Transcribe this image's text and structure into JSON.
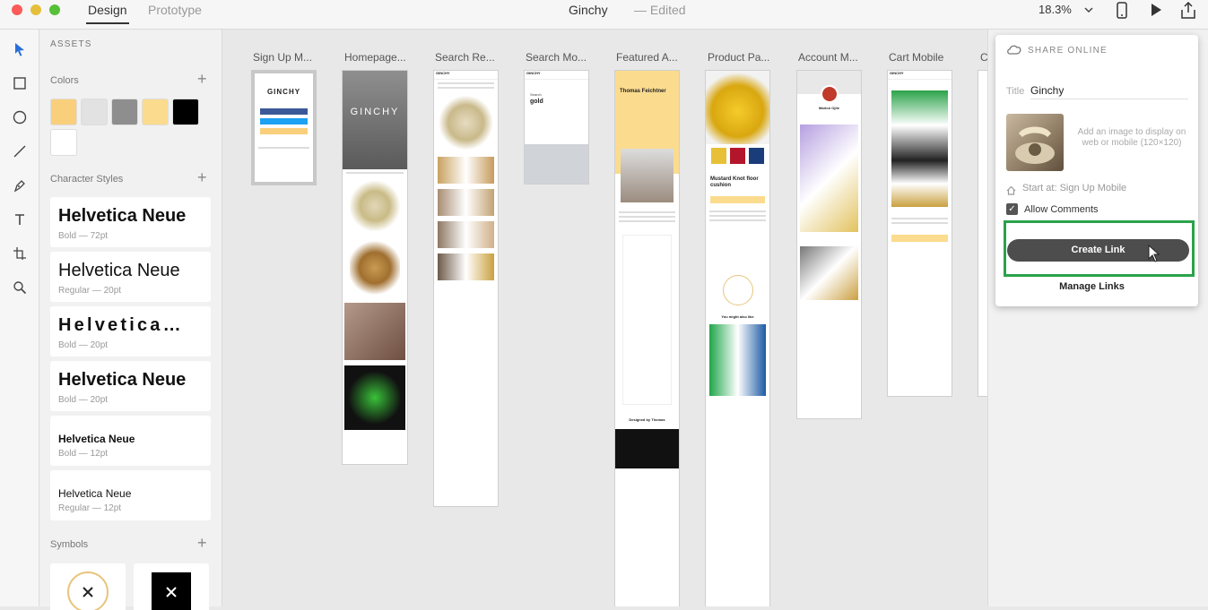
{
  "titlebar": {
    "tabs": [
      {
        "label": "Design"
      },
      {
        "label": "Prototype"
      }
    ],
    "doc_title": "Ginchy",
    "doc_status": "— Edited",
    "zoom": "18.3%"
  },
  "toolbar": {
    "tools": [
      "select-tool",
      "rectangle-tool",
      "ellipse-tool",
      "line-tool",
      "pen-tool",
      "text-tool",
      "artboard-tool",
      "zoom-tool"
    ]
  },
  "assets": {
    "heading": "ASSETS",
    "colors_title": "Colors",
    "colors": [
      "#f9cf7c",
      "#e2e2e2",
      "#8e8e8e",
      "#fbdb8e",
      "#000000",
      "#ffffff"
    ],
    "char_styles_title": "Character Styles",
    "char_styles": [
      {
        "name": "Helvetica Neue",
        "meta": "Bold — 72pt"
      },
      {
        "name": "Helvetica Neue",
        "meta": "Regular — 20pt"
      },
      {
        "name": "Helvetica…",
        "meta": "Bold — 20pt"
      },
      {
        "name": "Helvetica Neue",
        "meta": "Bold — 20pt"
      },
      {
        "name": "Helvetica Neue",
        "meta": "Bold — 12pt"
      },
      {
        "name": "Helvetica Neue",
        "meta": "Regular — 12pt"
      }
    ],
    "symbols_title": "Symbols"
  },
  "artboards": [
    {
      "label": "Sign Up M..."
    },
    {
      "label": "Homepage..."
    },
    {
      "label": "Search Re..."
    },
    {
      "label": "Search Mo..."
    },
    {
      "label": "Featured A..."
    },
    {
      "label": "Product Pa..."
    },
    {
      "label": "Account M..."
    },
    {
      "label": "Cart Mobile"
    },
    {
      "label": "C"
    }
  ],
  "artboard_text": {
    "logo": "GINCHY",
    "search_label": "Search",
    "search_term": "gold",
    "featured_name": "Thomas Feichtner",
    "product_title": "Mustard Knot floor cushion",
    "account_name": "Marlon Ojile",
    "also_like": "You might also like",
    "designed_by": "Designed by Thomas"
  },
  "share": {
    "title": "SHARE ONLINE",
    "title_label": "Title",
    "title_value": "Ginchy",
    "image_hint": "Add an image to display on web or mobile (120×120)",
    "start_at": "Start at: Sign Up Mobile",
    "allow_comments": "Allow Comments",
    "allow_comments_checked": true,
    "create_link": "Create Link",
    "manage_links": "Manage Links"
  }
}
